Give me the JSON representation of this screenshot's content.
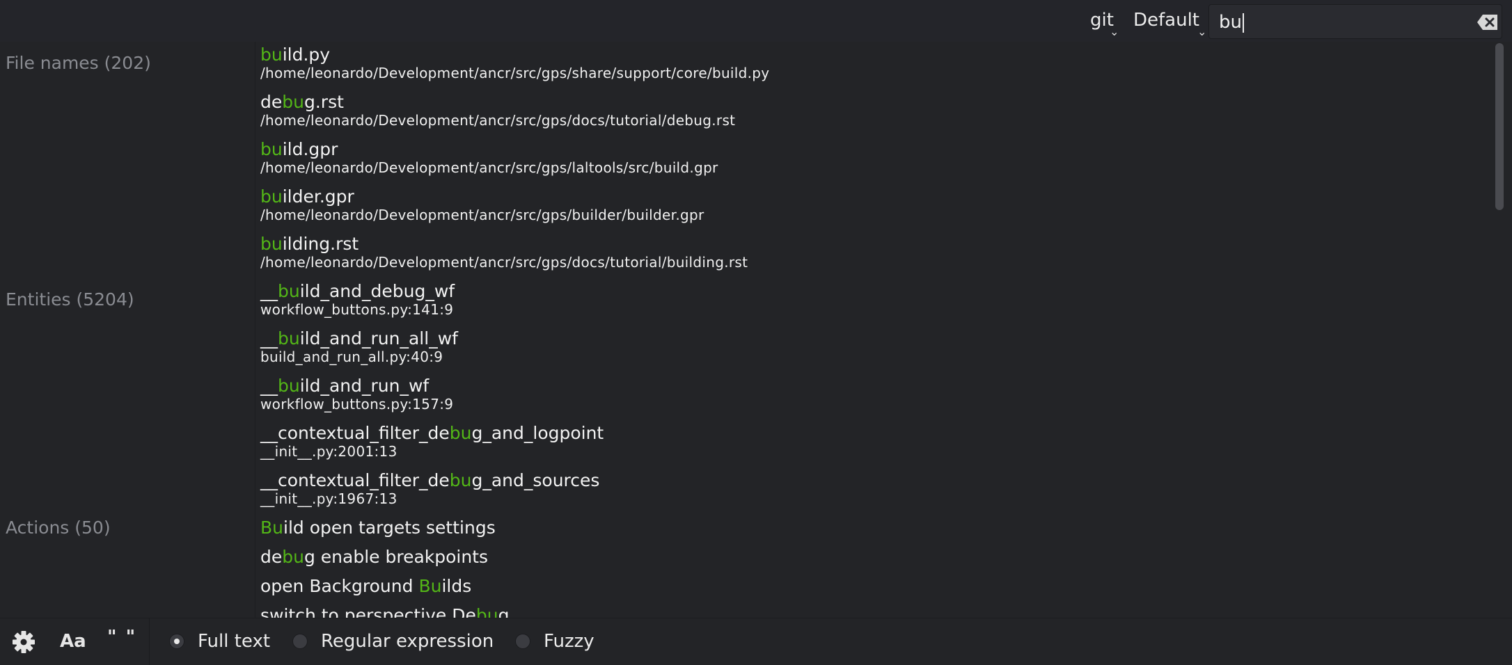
{
  "topbar": {
    "vcs_label": "git",
    "scope_label": "Default",
    "search": {
      "value": "bu",
      "placeholder": ""
    },
    "icons": {
      "dropdown": "chevron-down-icon",
      "clear": "backspace-clear-icon"
    }
  },
  "categories": [
    {
      "id": "files",
      "label": "File names (202)"
    },
    {
      "id": "entities",
      "label": "Entities (5204)"
    },
    {
      "id": "actions",
      "label": "Actions (50)"
    }
  ],
  "results": [
    {
      "category": "files",
      "pre": "",
      "match": "bu",
      "post": "ild.py",
      "sub": "/home/leonardo/Development/ancr/src/gps/share/support/core/build.py"
    },
    {
      "category": "files",
      "pre": "de",
      "match": "bu",
      "post": "g.rst",
      "sub": "/home/leonardo/Development/ancr/src/gps/docs/tutorial/debug.rst"
    },
    {
      "category": "files",
      "pre": "",
      "match": "bu",
      "post": "ild.gpr",
      "sub": "/home/leonardo/Development/ancr/src/gps/laltools/src/build.gpr"
    },
    {
      "category": "files",
      "pre": "",
      "match": "bu",
      "post": "ilder.gpr",
      "sub": "/home/leonardo/Development/ancr/src/gps/builder/builder.gpr"
    },
    {
      "category": "files",
      "pre": "",
      "match": "bu",
      "post": "ilding.rst",
      "sub": "/home/leonardo/Development/ancr/src/gps/docs/tutorial/building.rst"
    },
    {
      "category": "entities",
      "pre": "__",
      "match": "bu",
      "post": "ild_and_debug_wf",
      "sub": "workflow_buttons.py:141:9"
    },
    {
      "category": "entities",
      "pre": "__",
      "match": "bu",
      "post": "ild_and_run_all_wf",
      "sub": "build_and_run_all.py:40:9"
    },
    {
      "category": "entities",
      "pre": "__",
      "match": "bu",
      "post": "ild_and_run_wf",
      "sub": "workflow_buttons.py:157:9"
    },
    {
      "category": "entities",
      "pre": "__contextual_filter_de",
      "match": "bu",
      "post": "g_and_logpoint",
      "sub": "__init__.py:2001:13"
    },
    {
      "category": "entities",
      "pre": "__contextual_filter_de",
      "match": "bu",
      "post": "g_and_sources",
      "sub": "__init__.py:1967:13"
    },
    {
      "category": "actions",
      "pre": "",
      "match": "Bu",
      "post": "ild open targets settings",
      "sub": ""
    },
    {
      "category": "actions",
      "pre": "de",
      "match": "bu",
      "post": "g enable breakpoints",
      "sub": ""
    },
    {
      "category": "actions",
      "pre": "open Background ",
      "match": "Bu",
      "post": "ilds",
      "sub": ""
    },
    {
      "category": "actions",
      "pre": "switch to perspective De",
      "match": "bu",
      "post": "g",
      "sub": ""
    }
  ],
  "bottombar": {
    "settings_icon": "gear-icon",
    "case_label": "Aa",
    "quote_label": "\" \"",
    "modes": [
      {
        "label": "Full text",
        "selected": true
      },
      {
        "label": "Regular expression",
        "selected": false
      },
      {
        "label": "Fuzzy",
        "selected": false
      }
    ]
  },
  "colors": {
    "highlight": "#53b617",
    "background": "#232427",
    "category_text": "#8a8c92"
  }
}
